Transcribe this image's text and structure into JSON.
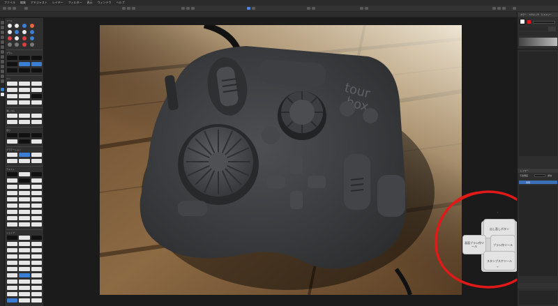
{
  "menubar": {
    "items": [
      "ファイル",
      "編集",
      "アドジャスト",
      "レイヤー",
      "フィルター",
      "表示",
      "ウィンドウ",
      "ヘルプ"
    ]
  },
  "document": {
    "tab_label": "TourBox-Elite_tourbox.jpg"
  },
  "palette": {
    "sections": [
      "ツール",
      "ブラシ",
      "ペン",
      "消しゴム",
      "塗り",
      "グラデーション",
      "テキスト",
      "シェイプ"
    ]
  },
  "dial_popup": {
    "top_label": "出し直しボタン",
    "left_label": "画面ブラシ作ツール",
    "right_label": "ブラシ作ツール",
    "bottom_label": "スタンプスケツール",
    "arrow_up": "˄",
    "arrow_down": "˅",
    "arrow_left": "‹",
    "arrow_right": "›"
  },
  "right_panel": {
    "tabs": [
      "カラー",
      "スウォッチ",
      "ヒストリー"
    ],
    "layers_title": "レイヤー",
    "layer_name": "背景",
    "opacity_label": "不透明度",
    "blend_mode": "通常"
  },
  "colors": {
    "annotation_ring": "#e11919",
    "accent_blue": "#3b7fd4",
    "ui_dark": "#2e2e2e"
  }
}
